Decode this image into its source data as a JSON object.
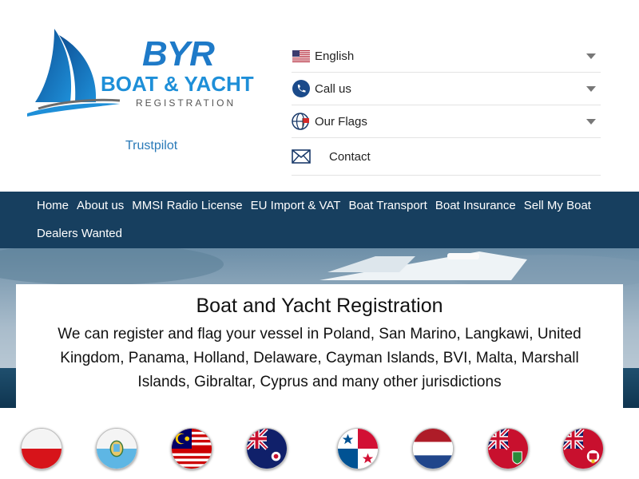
{
  "brand": {
    "logo_initials": "BYR",
    "logo_name": "BOAT & YACHT",
    "logo_tagline": "REGISTRATION",
    "trustpilot": "Trustpilot"
  },
  "selectors": {
    "language": "English",
    "call": "Call us",
    "flags": "Our Flags",
    "contact": "Contact"
  },
  "nav": {
    "items": [
      "Home",
      "About us",
      "MMSI Radio License",
      "EU Import & VAT",
      "Boat Transport",
      "Boat Insurance",
      "Sell My Boat",
      "Dealers Wanted"
    ]
  },
  "hero": {
    "title": "Boat and Yacht Registration",
    "description": "We can register and flag your vessel in Poland, San Marino, Langkawi, United Kingdom, Panama, Holland, Delaware, Cayman Islands, BVI, Malta, Marshall Islands, Gibraltar, Cyprus and many other jurisdictions"
  },
  "flags": [
    "Poland",
    "San Marino",
    "Langkawi",
    "Cayman Islands",
    "Panama",
    "Holland",
    "BVI",
    "Gibraltar"
  ],
  "colors": {
    "nav_bg": "#173f5f",
    "brand_blue": "#1e7ac8",
    "link": "#2a7ab8"
  }
}
